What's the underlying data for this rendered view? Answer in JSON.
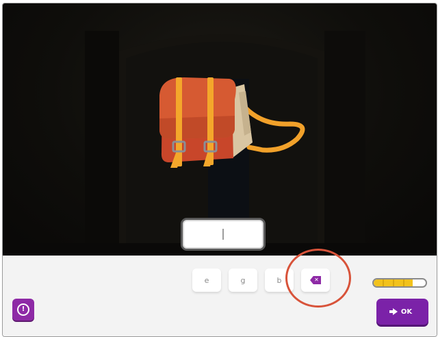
{
  "scene": {
    "object_icon": "backpack-icon"
  },
  "answer": {
    "value": ""
  },
  "keyboard": {
    "letters": [
      "e",
      "g",
      "b"
    ],
    "delete_icon": "backspace-icon",
    "highlighted_key": "delete"
  },
  "progress": {
    "fraction": 0.75
  },
  "buttons": {
    "help_icon": "help-icon",
    "ok_label": "OK"
  },
  "colors": {
    "accent": "#7b22a8",
    "progress": "#f2c21c",
    "highlight": "#d8533a"
  }
}
